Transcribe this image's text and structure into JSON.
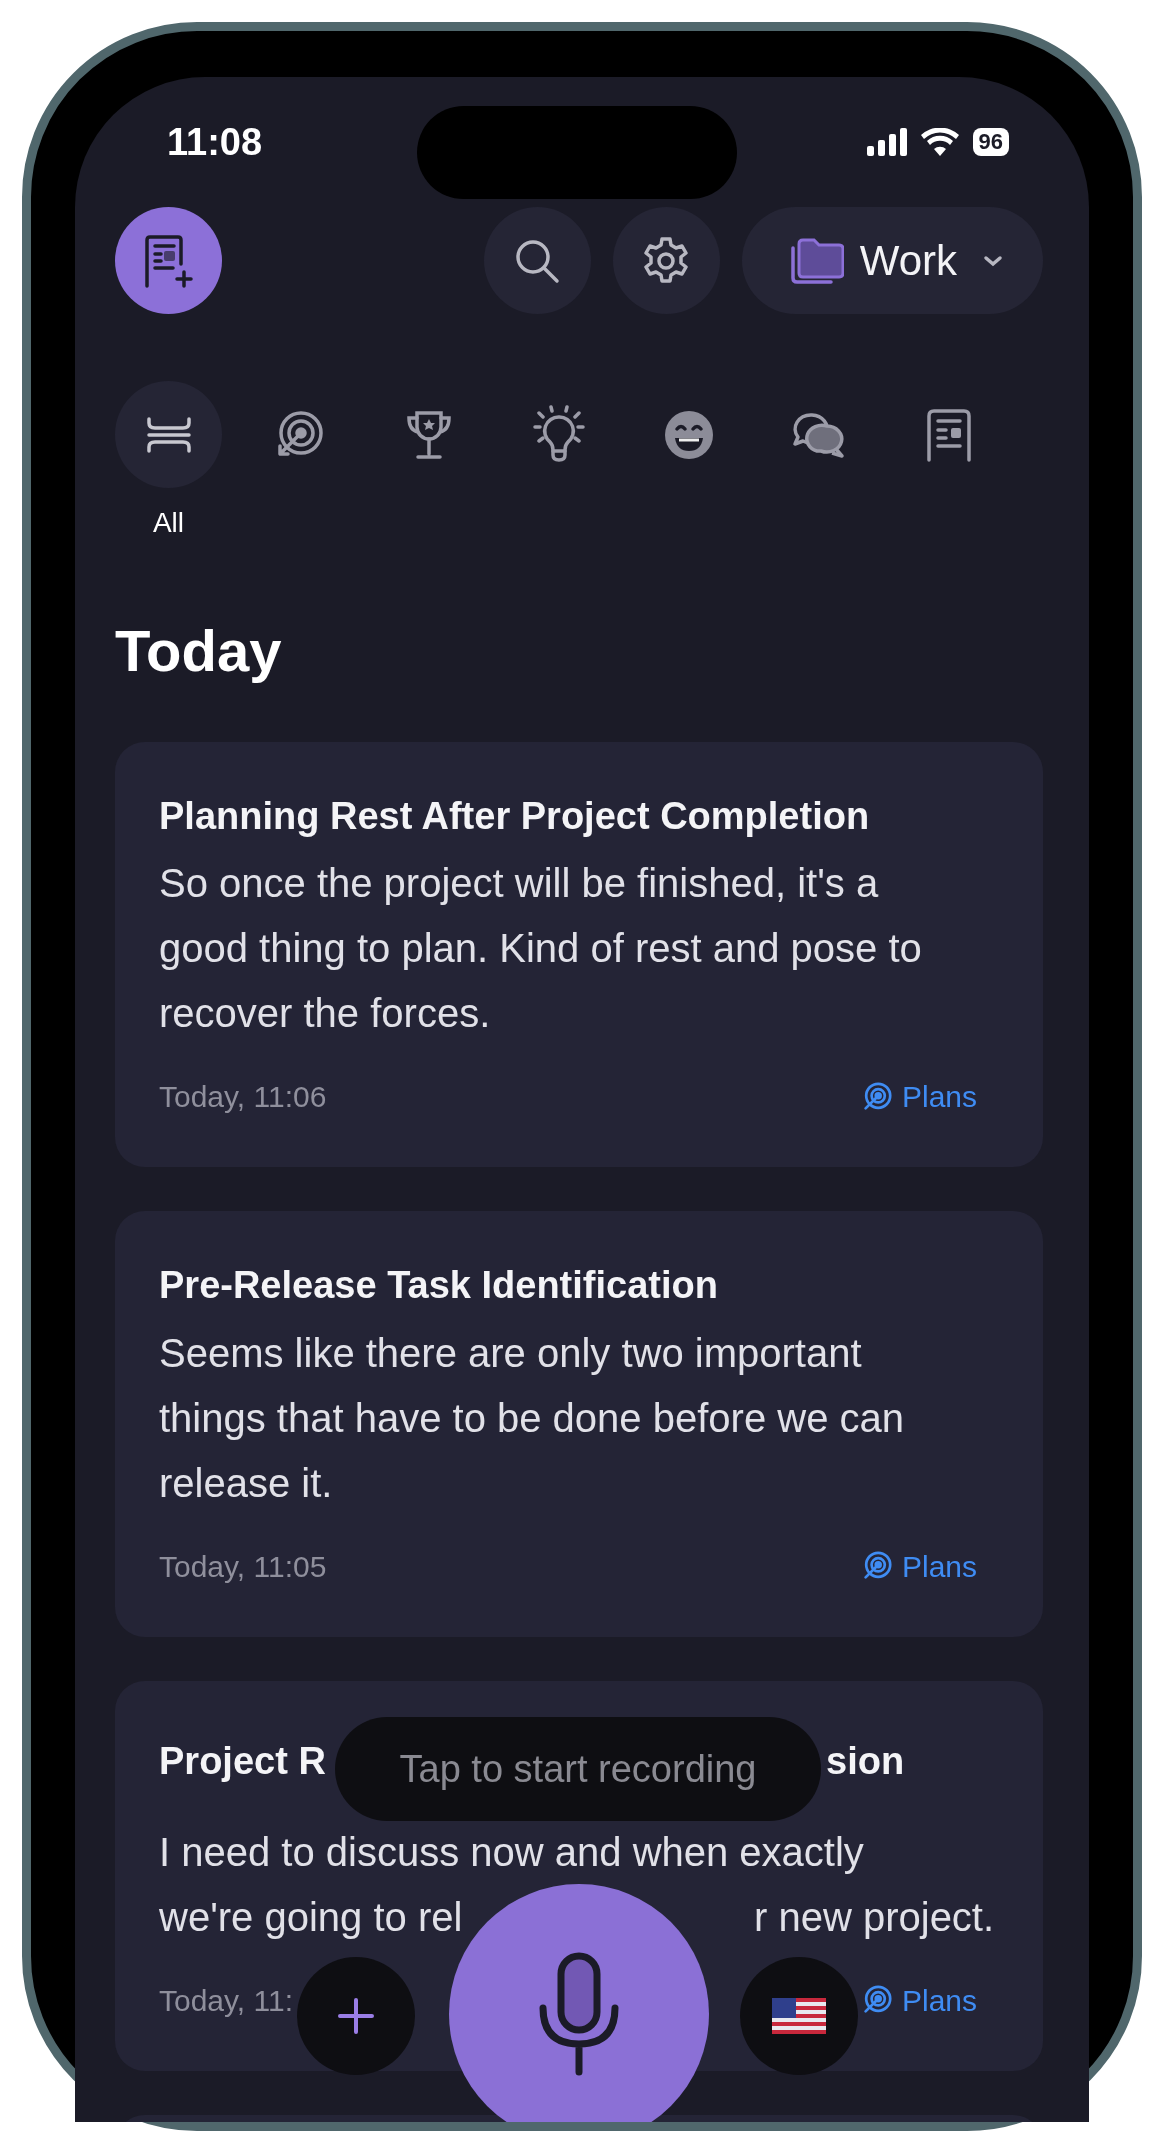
{
  "status_bar": {
    "time": "11:08",
    "battery": "96"
  },
  "header": {
    "folder": "Work"
  },
  "categories": [
    {
      "kind": "all",
      "label": "All",
      "selected": true
    },
    {
      "kind": "target",
      "selected": false
    },
    {
      "kind": "trophy",
      "selected": false
    },
    {
      "kind": "bulb",
      "selected": false
    },
    {
      "kind": "smile",
      "selected": false
    },
    {
      "kind": "chat",
      "selected": false
    },
    {
      "kind": "document",
      "selected": false
    }
  ],
  "section_title": "Today",
  "notes": [
    {
      "kind": "full",
      "title": "Planning Rest After Project Completion",
      "body": "So once the project will be finished, it's a good thing to plan. Kind of rest and pose to recover the forces.",
      "time": "Today, 11:06",
      "tag": "Plans"
    },
    {
      "kind": "full",
      "title": "Pre-Release Task Identification",
      "body": "Seems like there are only two important things that have to be done before we can release it.",
      "time": "Today, 11:05",
      "tag": "Plans"
    },
    {
      "kind": "covered",
      "title_parts": [
        "Project R",
        "sion"
      ],
      "body_lines": [
        [
          "I need to discuss now and when exactly"
        ],
        [
          "we're going to rel",
          "r new project."
        ]
      ],
      "time": "Today, 11:",
      "tag": "Plans"
    },
    {
      "kind": "clipped"
    }
  ],
  "recorder": {
    "hint": "Tap to start recording"
  }
}
